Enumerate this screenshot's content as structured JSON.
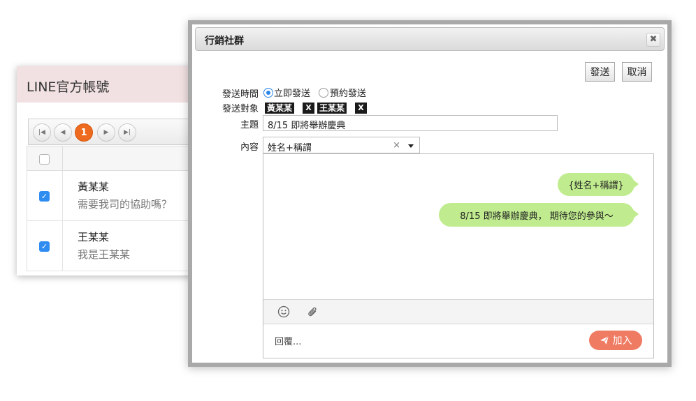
{
  "background": {
    "title": "LINE官方帳號",
    "pager": {
      "current_page": "1"
    },
    "rows": [
      {
        "name": "黃某某",
        "message": "需要我司的協助嗎？",
        "checked": true
      },
      {
        "name": "王某某",
        "message": "我是王某某",
        "checked": true
      }
    ]
  },
  "dialog": {
    "title": "行銷社群",
    "close_label": "✖",
    "send_button": "發送",
    "cancel_button": "取消",
    "labels": {
      "send_time": "發送時間",
      "recipients": "發送對象",
      "subject": "主題",
      "content": "內容"
    },
    "send_options": [
      {
        "label": "立即發送",
        "selected": true
      },
      {
        "label": "預約發送",
        "selected": false
      }
    ],
    "recipients": [
      "黃某某",
      "王某某"
    ],
    "recipient_remove": "X",
    "subject_value": "8/15 即將舉辦慶典",
    "content_select": {
      "value": "姓名+稱謂",
      "clear": "×"
    },
    "bubbles": [
      "{姓名+稱謂}",
      "8/15 即將舉辦慶典， 期待您的參與～"
    ],
    "reply_placeholder": "回覆...",
    "add_button": "加入",
    "colors": {
      "bubble": "#c0ec8f",
      "add_button": "#ef7b63",
      "page_active": "#ee6a1e",
      "checkbox": "#2f8cf0"
    }
  }
}
